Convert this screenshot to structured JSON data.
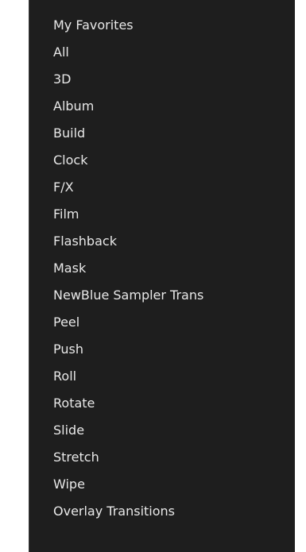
{
  "menu": {
    "items": [
      {
        "label": "My Favorites"
      },
      {
        "label": "All"
      },
      {
        "label": "3D"
      },
      {
        "label": "Album"
      },
      {
        "label": "Build"
      },
      {
        "label": "Clock"
      },
      {
        "label": "F/X"
      },
      {
        "label": "Film"
      },
      {
        "label": "Flashback"
      },
      {
        "label": "Mask"
      },
      {
        "label": "NewBlue Sampler Trans"
      },
      {
        "label": "Peel"
      },
      {
        "label": "Push"
      },
      {
        "label": "Roll"
      },
      {
        "label": "Rotate"
      },
      {
        "label": "Slide"
      },
      {
        "label": "Stretch"
      },
      {
        "label": "Wipe"
      },
      {
        "label": "Overlay Transitions"
      }
    ]
  },
  "colors": {
    "background": "#1e1e1e",
    "text": "#e8e8e8"
  }
}
